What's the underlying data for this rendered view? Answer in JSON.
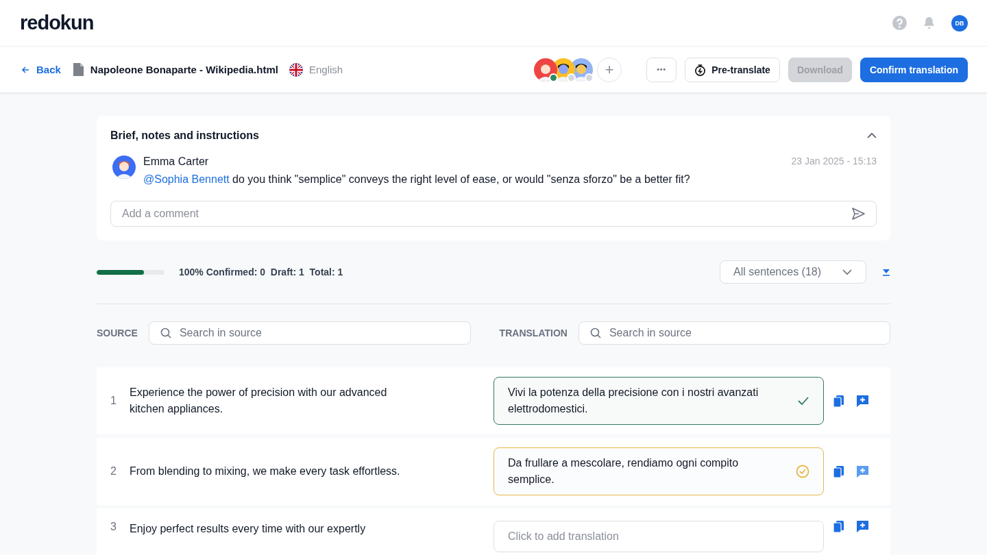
{
  "logo": "redokun",
  "top_actions": {
    "user_initials": "DB"
  },
  "toolbar": {
    "back": "Back",
    "file_name": "Napoleone Bonaparte - Wikipedia.html",
    "language": "English",
    "add_collaborator": "+",
    "collaborators": [
      {
        "online": true
      },
      {
        "online": false
      },
      {
        "online": false
      }
    ],
    "buttons": [
      {
        "kind": "more",
        "label": "•••",
        "disabled": false
      },
      {
        "kind": "pretranslate",
        "label": "Pre-translate",
        "disabled": false
      },
      {
        "kind": "download",
        "label": "Download",
        "disabled": true
      },
      {
        "kind": "confirm",
        "label": "Confirm translation",
        "disabled": false
      }
    ]
  },
  "brief": {
    "title": "Brief, notes and instructions",
    "expanded": true,
    "comment": {
      "author": "Emma Carter",
      "time": "23 Jan 2025 - 15:13",
      "mention": "@Sophia Bennett",
      "text": "do you think \"semplice\" conveys the right level of ease, or would \"senza sforzo\" be a better fit?"
    },
    "input": {
      "placeholder": "Add a comment"
    }
  },
  "progress": {
    "level": 0.7,
    "summary": "100% Confirmed: 0  Draft: 1  Total: 1",
    "filter": "All sentences (18)"
  },
  "columns": {
    "source_label": "SOURCE",
    "source_search": "Search in source",
    "translation_label": "TRANSLATION",
    "translation_search": "Search in source"
  },
  "segments": [
    {
      "number": "1",
      "source": "Experience the power of precision with our advanced kitchen appliances.",
      "translation": "Vivi la potenza della precisione con i nostri avanzati elettrodomestici.",
      "kind": "confirmed"
    },
    {
      "number": "2",
      "source": "From blending to mixing, we make every task effortless.",
      "translation": "Da frullare a mescolare, rendiamo ogni compito semplice.",
      "kind": "draft"
    },
    {
      "number": "3",
      "source": "Enjoy perfect results every time with our expertly",
      "placeholder": "Click to add translation",
      "kind": "empty"
    }
  ]
}
